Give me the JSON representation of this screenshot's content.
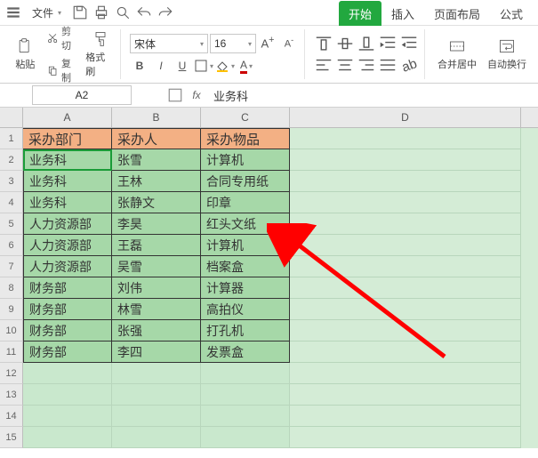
{
  "menubar": {
    "file_label": "文件",
    "tabs": [
      "开始",
      "插入",
      "页面布局",
      "公式"
    ],
    "active_tab": 0
  },
  "ribbon": {
    "paste_label": "粘贴",
    "cut_label": "剪切",
    "copy_label": "复制",
    "formatpainter_label": "格式刷",
    "font_name": "宋体",
    "font_size": "16",
    "merge_label": "合并居中",
    "wrap_label": "自动换行"
  },
  "formula_bar": {
    "name_box": "A2",
    "formula_value": "业务科"
  },
  "sheet": {
    "columns": [
      "A",
      "B",
      "C",
      "D"
    ],
    "header_row": [
      "采办部门",
      "采办人",
      "采办物品"
    ],
    "data_rows": [
      [
        "业务科",
        "张雪",
        "计算机"
      ],
      [
        "业务科",
        "王林",
        "合同专用纸"
      ],
      [
        "业务科",
        "张静文",
        "印章"
      ],
      [
        "人力资源部",
        "李昊",
        "红头文纸"
      ],
      [
        "人力资源部",
        "王磊",
        "计算机"
      ],
      [
        "人力资源部",
        "吴雪",
        "档案盒"
      ],
      [
        "财务部",
        "刘伟",
        "计算器"
      ],
      [
        "财务部",
        "林雪",
        "高拍仪"
      ],
      [
        "财务部",
        "张强",
        "打孔机"
      ],
      [
        "财务部",
        "李四",
        "发票盒"
      ]
    ],
    "empty_rows": [
      12,
      13,
      14,
      15
    ],
    "selected_cell": "A2"
  }
}
